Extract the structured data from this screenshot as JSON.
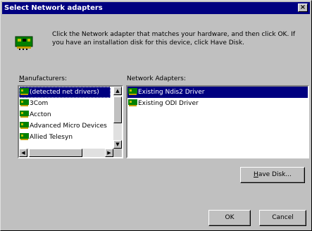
{
  "window": {
    "title": "Select Network adapters",
    "close_glyph": "×"
  },
  "instruction": "Click the Network adapter that matches your hardware, and then click OK. If you have an installation disk for this device, click Have Disk.",
  "manufacturers": {
    "label_prefix": "M",
    "label_rest": "anufacturers:",
    "items": [
      "(detected net drivers)",
      "3Com",
      "Accton",
      "Advanced Micro Devices",
      "Allied Telesyn"
    ],
    "selected": "(detected net drivers)"
  },
  "adapters": {
    "label": "Network Adapters:",
    "items": [
      "Existing Ndis2 Driver",
      "Existing ODI Driver"
    ],
    "selected": "Existing Ndis2 Driver"
  },
  "buttons": {
    "have_disk_prefix": "H",
    "have_disk_rest": "ave Disk...",
    "ok": "OK",
    "cancel": "Cancel"
  },
  "icons": {
    "adapter_icon": "network-card-icon",
    "scroll_up": "▲",
    "scroll_down": "▼",
    "scroll_left": "◀",
    "scroll_right": "▶"
  },
  "colors": {
    "selection": "#000080",
    "icon_green": "#008000"
  }
}
